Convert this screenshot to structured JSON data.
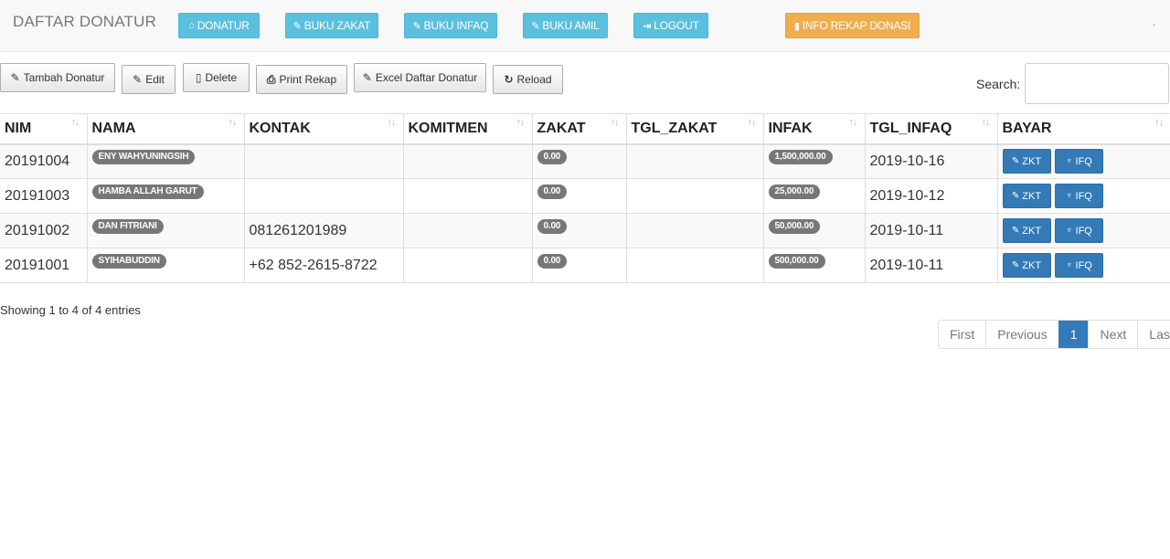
{
  "nav": {
    "brand": "DAFTAR DONATUR",
    "buttons": [
      {
        "icon": "home-icon",
        "glyph": "⌂",
        "label": "DONATUR"
      },
      {
        "icon": "edit-icon",
        "glyph": "✎",
        "label": "BUKU ZAKAT"
      },
      {
        "icon": "edit-icon",
        "glyph": "✎",
        "label": "BUKU INFAQ"
      },
      {
        "icon": "edit-icon",
        "glyph": "✎",
        "label": "BUKU AMIL"
      },
      {
        "icon": "logout-icon",
        "glyph": "⇥",
        "label": "LOGOUT"
      },
      {
        "icon": "file-icon",
        "glyph": "▮",
        "label": "INFO REKAP DONASI"
      }
    ],
    "dot": "."
  },
  "toolbar": {
    "add_label": "Tambah Donatur",
    "edit_label": "Edit",
    "delete_label": "Delete",
    "print_label": "Print Rekap",
    "excel_label": "Excel Daftar Donatur",
    "reload_label": "Reload",
    "icons": {
      "edit": "✎",
      "delete": "▯",
      "print": "⎙",
      "reload": "↻"
    }
  },
  "search": {
    "label": "Search:",
    "value": "",
    "placeholder": ""
  },
  "table": {
    "columns": [
      "NIM",
      "NAMA",
      "KONTAK",
      "KOMITMEN",
      "ZAKAT",
      "TGL_ZAKAT",
      "INFAK",
      "TGL_INFAQ",
      "BAYAR"
    ],
    "sort_glyph": "↑↓",
    "rows": [
      {
        "nim": "20191004",
        "nama": "ENY WAHYUNINGSIH",
        "kontak": "",
        "komitmen": "",
        "zakat": "0.00",
        "tgl_zakat": "",
        "infak": "1,500,000.00",
        "tgl_infaq": "2019-10-16"
      },
      {
        "nim": "20191003",
        "nama": "HAMBA ALLAH GARUT",
        "kontak": "",
        "komitmen": "",
        "zakat": "0.00",
        "tgl_zakat": "",
        "infak": "25,000.00",
        "tgl_infaq": "2019-10-12"
      },
      {
        "nim": "20191002",
        "nama": "DAN FITRIANI",
        "kontak": "081261201989",
        "komitmen": "",
        "zakat": "0.00",
        "tgl_zakat": "",
        "infak": "50,000.00",
        "tgl_infaq": "2019-10-11"
      },
      {
        "nim": "20191001",
        "nama": "SYIHABUDDIN",
        "kontak": "+62 852-2615-8722",
        "komitmen": "",
        "zakat": "0.00",
        "tgl_zakat": "",
        "infak": "500,000.00",
        "tgl_infaq": "2019-10-11"
      }
    ],
    "pay_buttons": {
      "zakat_label": "ZKT",
      "infaq_label": "IFQ",
      "zakat_glyph": "✎",
      "infaq_glyph": "♆"
    }
  },
  "footer": {
    "info": "Showing 1 to 4 of 4 entries",
    "pagination": [
      "First",
      "Previous",
      "1",
      "Next",
      "Last"
    ],
    "active_page": "1"
  },
  "colors": {
    "info": "#5bc0de",
    "warning": "#f0ad4e",
    "primary": "#337ab7",
    "badge": "#777777"
  }
}
